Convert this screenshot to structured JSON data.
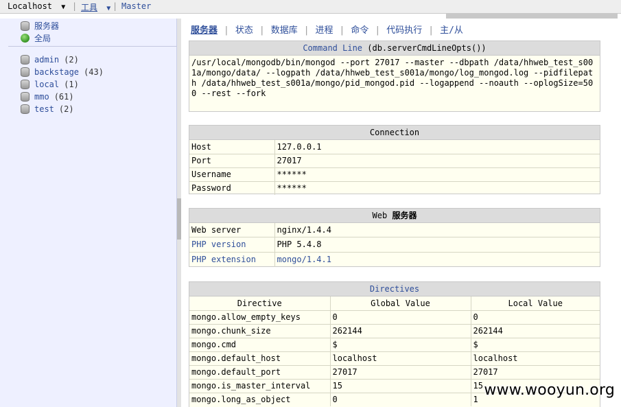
{
  "topbar": {
    "host": "Localhost",
    "sep1": "|",
    "tools": "工具",
    "sep2": "|",
    "master": "Master"
  },
  "sidebar": {
    "top_items": [
      {
        "label": "服务器",
        "icon": "server-icon"
      },
      {
        "label": "全局",
        "icon": "globe-icon"
      }
    ],
    "databases": [
      {
        "name": "admin",
        "count": "(2)"
      },
      {
        "name": "backstage",
        "count": "(43)"
      },
      {
        "name": "local",
        "count": "(1)"
      },
      {
        "name": "mmo",
        "count": "(61)"
      },
      {
        "name": "test",
        "count": "(2)"
      }
    ]
  },
  "tabs": [
    "服务器",
    "状态",
    "数据库",
    "进程",
    "命令",
    "代码执行",
    "主/从"
  ],
  "tab_sep": "|",
  "command_line": {
    "title_link": "Command Line",
    "title_rest": " (db.serverCmdLineOpts())",
    "value": "/usr/local/mongodb/bin/mongod --port 27017 --master --dbpath /data/hhweb_test_s001a/mongo/data/ --logpath /data/hhweb_test_s001a/mongo/log_mongod.log --pidfilepath /data/hhweb_test_s001a/mongo/pid_mongod.pid --logappend --noauth --oplogSize=500 --rest --fork"
  },
  "connection": {
    "title": "Connection",
    "rows": [
      {
        "key": "Host",
        "value": "127.0.0.1"
      },
      {
        "key": "Port",
        "value": "27017"
      },
      {
        "key": "Username",
        "value": "******"
      },
      {
        "key": "Password",
        "value": "******"
      }
    ]
  },
  "web_server": {
    "title_prefix": "Web ",
    "title_suffix": "服务器",
    "rows": [
      {
        "key": "Web server",
        "value": "nginx/1.4.4",
        "key_link": false,
        "value_link": false
      },
      {
        "key": "PHP version",
        "value": "PHP 5.4.8",
        "key_link": true,
        "value_link": false
      },
      {
        "key": "PHP extension",
        "value": "mongo/1.4.1",
        "key_link": true,
        "value_link": true
      }
    ]
  },
  "directives": {
    "title": "Directives",
    "headers": [
      "Directive",
      "Global Value",
      "Local Value"
    ],
    "rows": [
      [
        "mongo.allow_empty_keys",
        "0",
        "0"
      ],
      [
        "mongo.chunk_size",
        "262144",
        "262144"
      ],
      [
        "mongo.cmd",
        "$",
        "$"
      ],
      [
        "mongo.default_host",
        "localhost",
        "localhost"
      ],
      [
        "mongo.default_port",
        "27017",
        "27017"
      ],
      [
        "mongo.is_master_interval",
        "15",
        "15"
      ],
      [
        "mongo.long_as_object",
        "0",
        "1"
      ]
    ]
  },
  "watermark": "www.wooyun.org",
  "colors": {
    "link": "#2e4e9a",
    "panel_bg": "#fffff0",
    "panel_head": "#dcdcdc",
    "sidebar_bg": "#eef0ff"
  }
}
